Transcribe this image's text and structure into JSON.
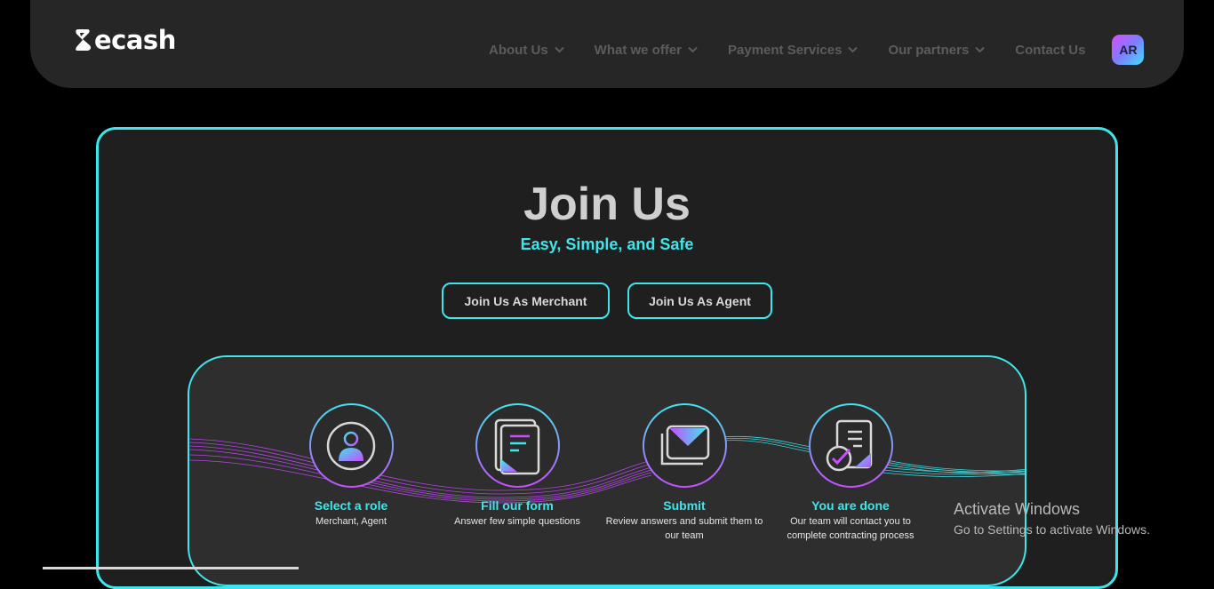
{
  "header": {
    "logo_text": "ecash",
    "nav": [
      {
        "label": "About Us",
        "has_dropdown": true
      },
      {
        "label": "What we offer",
        "has_dropdown": true
      },
      {
        "label": "Payment Services",
        "has_dropdown": true
      },
      {
        "label": "Our partners",
        "has_dropdown": true
      },
      {
        "label": "Contact Us",
        "has_dropdown": false
      }
    ],
    "avatar_initials": "AR"
  },
  "join": {
    "title": "Join Us",
    "subtitle": "Easy, Simple, and Safe",
    "merchant_button": "Join Us As Merchant",
    "agent_button": "Join Us As Agent"
  },
  "steps": [
    {
      "icon": "user-icon",
      "title": "Select a role",
      "desc": "Merchant, Agent"
    },
    {
      "icon": "document-icon",
      "title": "Fill our form",
      "desc": "Answer few simple questions"
    },
    {
      "icon": "envelope-icon",
      "title": "Submit",
      "desc": "Review answers and submit them to our team"
    },
    {
      "icon": "checklist-icon",
      "title": "You are done",
      "desc": "Our team will contact you to complete contracting process"
    }
  ],
  "watermark": {
    "line1": "Activate Windows",
    "line2": "Go to Settings to activate Windows."
  },
  "colors": {
    "accent": "#3ee6ec",
    "gradient_pink": "#c84dff",
    "background": "#000000",
    "panel": "#1f1f1f"
  }
}
